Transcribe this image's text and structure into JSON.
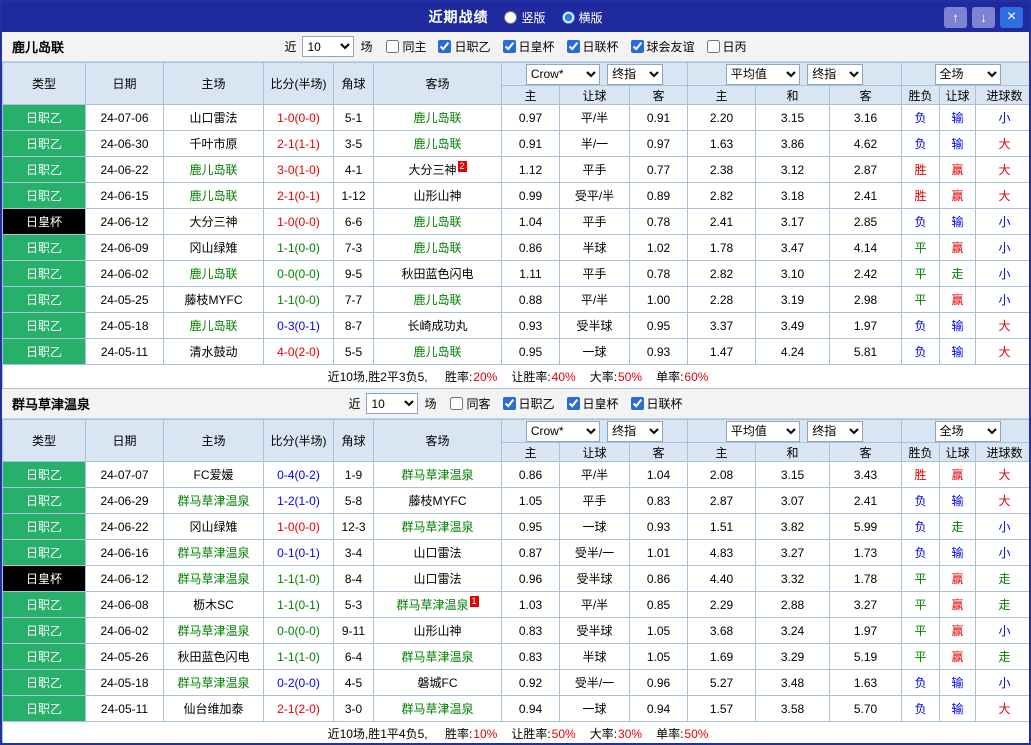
{
  "titlebar": {
    "title": "近期战绩",
    "layout_options": [
      {
        "label": "竖版",
        "selected": false
      },
      {
        "label": "横版",
        "selected": true
      }
    ],
    "buttons": {
      "up": "↑",
      "down": "↓",
      "close": "×"
    }
  },
  "table": {
    "columns": [
      "类型",
      "日期",
      "主场",
      "比分(半场)",
      "角球",
      "客场"
    ],
    "sub_headers": [
      "主",
      "让球",
      "客",
      "主",
      "和",
      "客",
      "胜负",
      "让球",
      "进球数"
    ]
  },
  "colors": {
    "focus_team": "#008000",
    "score": {
      "home": "#e60000",
      "away": "#0000ee",
      "draw": "#008000"
    },
    "outcome": {
      "胜": "#e60000",
      "赢": "#e60000",
      "大": "#e60000",
      "平": "#008000",
      "走": "#008000",
      "负": "#0000ee",
      "输": "#0000ee",
      "小": "#0000ee"
    },
    "comp": {
      "日职乙": "#27b06a",
      "日皇杯": "#000000"
    }
  },
  "sections": [
    {
      "team": "鹿儿岛联",
      "filter": {
        "near_label": "近",
        "count": "10",
        "games_label": "场",
        "checkboxes": [
          {
            "label": "同主",
            "checked": false
          },
          {
            "label": "日职乙",
            "checked": true
          },
          {
            "label": "日皇杯",
            "checked": true
          },
          {
            "label": "日联杯",
            "checked": true
          },
          {
            "label": "球会友谊",
            "checked": true
          },
          {
            "label": "日丙",
            "checked": false
          }
        ]
      },
      "dropdowns": {
        "company": "Crow*",
        "company_stage": "终指",
        "average": "平均值",
        "average_stage": "终指",
        "scope": "全场"
      },
      "rows": [
        {
          "comp": "日职乙",
          "date": "24-07-06",
          "home": "山口雷法",
          "home_focus": false,
          "home_badge": "",
          "score": "1-0(0-0)",
          "score_result": "home",
          "corner": "5-1",
          "away": "鹿儿岛联",
          "away_focus": true,
          "away_badge": "",
          "handicap": [
            "0.97",
            "平/半",
            "0.91"
          ],
          "europe": [
            "2.20",
            "3.15",
            "3.16"
          ],
          "outcome": [
            "负",
            "输",
            "小"
          ]
        },
        {
          "comp": "日职乙",
          "date": "24-06-30",
          "home": "千叶市原",
          "home_focus": false,
          "home_badge": "",
          "score": "2-1(1-1)",
          "score_result": "home",
          "corner": "3-5",
          "away": "鹿儿岛联",
          "away_focus": true,
          "away_badge": "",
          "handicap": [
            "0.91",
            "半/一",
            "0.97"
          ],
          "europe": [
            "1.63",
            "3.86",
            "4.62"
          ],
          "outcome": [
            "负",
            "输",
            "大"
          ]
        },
        {
          "comp": "日职乙",
          "date": "24-06-22",
          "home": "鹿儿岛联",
          "home_focus": true,
          "home_badge": "",
          "score": "3-0(1-0)",
          "score_result": "home",
          "corner": "4-1",
          "away": "大分三神",
          "away_focus": false,
          "away_badge": "2",
          "handicap": [
            "1.12",
            "平手",
            "0.77"
          ],
          "europe": [
            "2.38",
            "3.12",
            "2.87"
          ],
          "outcome": [
            "胜",
            "赢",
            "大"
          ]
        },
        {
          "comp": "日职乙",
          "date": "24-06-15",
          "home": "鹿儿岛联",
          "home_focus": true,
          "home_badge": "",
          "score": "2-1(0-1)",
          "score_result": "home",
          "corner": "1-12",
          "away": "山形山神",
          "away_focus": false,
          "away_badge": "",
          "handicap": [
            "0.99",
            "受平/半",
            "0.89"
          ],
          "europe": [
            "2.82",
            "3.18",
            "2.41"
          ],
          "outcome": [
            "胜",
            "赢",
            "大"
          ]
        },
        {
          "comp": "日皇杯",
          "date": "24-06-12",
          "home": "大分三神",
          "home_focus": false,
          "home_badge": "",
          "score": "1-0(0-0)",
          "score_result": "home",
          "corner": "6-6",
          "away": "鹿儿岛联",
          "away_focus": true,
          "away_badge": "",
          "handicap": [
            "1.04",
            "平手",
            "0.78"
          ],
          "europe": [
            "2.41",
            "3.17",
            "2.85"
          ],
          "outcome": [
            "负",
            "输",
            "小"
          ]
        },
        {
          "comp": "日职乙",
          "date": "24-06-09",
          "home": "冈山绿雉",
          "home_focus": false,
          "home_badge": "",
          "score": "1-1(0-0)",
          "score_result": "draw",
          "corner": "7-3",
          "away": "鹿儿岛联",
          "away_focus": true,
          "away_badge": "",
          "handicap": [
            "0.86",
            "半球",
            "1.02"
          ],
          "europe": [
            "1.78",
            "3.47",
            "4.14"
          ],
          "outcome": [
            "平",
            "赢",
            "小"
          ]
        },
        {
          "comp": "日职乙",
          "date": "24-06-02",
          "home": "鹿儿岛联",
          "home_focus": true,
          "home_badge": "",
          "score": "0-0(0-0)",
          "score_result": "draw",
          "corner": "9-5",
          "away": "秋田蓝色闪电",
          "away_focus": false,
          "away_badge": "",
          "handicap": [
            "1.11",
            "平手",
            "0.78"
          ],
          "europe": [
            "2.82",
            "3.10",
            "2.42"
          ],
          "outcome": [
            "平",
            "走",
            "小"
          ]
        },
        {
          "comp": "日职乙",
          "date": "24-05-25",
          "home": "藤枝MYFC",
          "home_focus": false,
          "home_badge": "",
          "score": "1-1(0-0)",
          "score_result": "draw",
          "corner": "7-7",
          "away": "鹿儿岛联",
          "away_focus": true,
          "away_badge": "",
          "handicap": [
            "0.88",
            "平/半",
            "1.00"
          ],
          "europe": [
            "2.28",
            "3.19",
            "2.98"
          ],
          "outcome": [
            "平",
            "赢",
            "小"
          ]
        },
        {
          "comp": "日职乙",
          "date": "24-05-18",
          "home": "鹿儿岛联",
          "home_focus": true,
          "home_badge": "",
          "score": "0-3(0-1)",
          "score_result": "away",
          "corner": "8-7",
          "away": "长崎成功丸",
          "away_focus": false,
          "away_badge": "",
          "handicap": [
            "0.93",
            "受半球",
            "0.95"
          ],
          "europe": [
            "3.37",
            "3.49",
            "1.97"
          ],
          "outcome": [
            "负",
            "输",
            "大"
          ]
        },
        {
          "comp": "日职乙",
          "date": "24-05-11",
          "home": "清水鼓动",
          "home_focus": false,
          "home_badge": "",
          "score": "4-0(2-0)",
          "score_result": "home",
          "corner": "5-5",
          "away": "鹿儿岛联",
          "away_focus": true,
          "away_badge": "",
          "handicap": [
            "0.95",
            "一球",
            "0.93"
          ],
          "europe": [
            "1.47",
            "4.24",
            "5.81"
          ],
          "outcome": [
            "负",
            "输",
            "大"
          ]
        }
      ],
      "summary": {
        "prefix": "近10场,胜2平3负5, ",
        "stats": [
          {
            "label": "胜率:",
            "value": "20%",
            "color": "#e60000"
          },
          {
            "label": "让胜率:",
            "value": "40%",
            "color": "#e60000"
          },
          {
            "label": "大率:",
            "value": "50%",
            "color": "#e60000"
          },
          {
            "label": "单率:",
            "value": "60%",
            "color": "#e60000"
          }
        ]
      }
    },
    {
      "team": "群马草津温泉",
      "filter": {
        "near_label": "近",
        "count": "10",
        "games_label": "场",
        "checkboxes": [
          {
            "label": "同客",
            "checked": false
          },
          {
            "label": "日职乙",
            "checked": true
          },
          {
            "label": "日皇杯",
            "checked": true
          },
          {
            "label": "日联杯",
            "checked": true
          }
        ]
      },
      "dropdowns": {
        "company": "Crow*",
        "company_stage": "终指",
        "average": "平均值",
        "average_stage": "终指",
        "scope": "全场"
      },
      "rows": [
        {
          "comp": "日职乙",
          "date": "24-07-07",
          "home": "FC爱媛",
          "home_focus": false,
          "home_badge": "",
          "score": "0-4(0-2)",
          "score_result": "away",
          "corner": "1-9",
          "away": "群马草津温泉",
          "away_focus": true,
          "away_badge": "",
          "handicap": [
            "0.86",
            "平/半",
            "1.04"
          ],
          "europe": [
            "2.08",
            "3.15",
            "3.43"
          ],
          "outcome": [
            "胜",
            "赢",
            "大"
          ]
        },
        {
          "comp": "日职乙",
          "date": "24-06-29",
          "home": "群马草津温泉",
          "home_focus": true,
          "home_badge": "",
          "score": "1-2(1-0)",
          "score_result": "away",
          "corner": "5-8",
          "away": "藤枝MYFC",
          "away_focus": false,
          "away_badge": "",
          "handicap": [
            "1.05",
            "平手",
            "0.83"
          ],
          "europe": [
            "2.87",
            "3.07",
            "2.41"
          ],
          "outcome": [
            "负",
            "输",
            "大"
          ]
        },
        {
          "comp": "日职乙",
          "date": "24-06-22",
          "home": "冈山绿雉",
          "home_focus": false,
          "home_badge": "",
          "score": "1-0(0-0)",
          "score_result": "home",
          "corner": "12-3",
          "away": "群马草津温泉",
          "away_focus": true,
          "away_badge": "",
          "handicap": [
            "0.95",
            "一球",
            "0.93"
          ],
          "europe": [
            "1.51",
            "3.82",
            "5.99"
          ],
          "outcome": [
            "负",
            "走",
            "小"
          ]
        },
        {
          "comp": "日职乙",
          "date": "24-06-16",
          "home": "群马草津温泉",
          "home_focus": true,
          "home_badge": "",
          "score": "0-1(0-1)",
          "score_result": "away",
          "corner": "3-4",
          "away": "山口雷法",
          "away_focus": false,
          "away_badge": "",
          "handicap": [
            "0.87",
            "受半/一",
            "1.01"
          ],
          "europe": [
            "4.83",
            "3.27",
            "1.73"
          ],
          "outcome": [
            "负",
            "输",
            "小"
          ]
        },
        {
          "comp": "日皇杯",
          "date": "24-06-12",
          "home": "群马草津温泉",
          "home_focus": true,
          "home_badge": "",
          "score": "1-1(1-0)",
          "score_result": "draw",
          "corner": "8-4",
          "away": "山口雷法",
          "away_focus": false,
          "away_badge": "",
          "handicap": [
            "0.96",
            "受半球",
            "0.86"
          ],
          "europe": [
            "4.40",
            "3.32",
            "1.78"
          ],
          "outcome": [
            "平",
            "赢",
            "走"
          ]
        },
        {
          "comp": "日职乙",
          "date": "24-06-08",
          "home": "枥木SC",
          "home_focus": false,
          "home_badge": "",
          "score": "1-1(0-1)",
          "score_result": "draw",
          "corner": "5-3",
          "away": "群马草津温泉",
          "away_focus": true,
          "away_badge": "1",
          "handicap": [
            "1.03",
            "平/半",
            "0.85"
          ],
          "europe": [
            "2.29",
            "2.88",
            "3.27"
          ],
          "outcome": [
            "平",
            "赢",
            "走"
          ]
        },
        {
          "comp": "日职乙",
          "date": "24-06-02",
          "home": "群马草津温泉",
          "home_focus": true,
          "home_badge": "",
          "score": "0-0(0-0)",
          "score_result": "draw",
          "corner": "9-11",
          "away": "山形山神",
          "away_focus": false,
          "away_badge": "",
          "handicap": [
            "0.83",
            "受半球",
            "1.05"
          ],
          "europe": [
            "3.68",
            "3.24",
            "1.97"
          ],
          "outcome": [
            "平",
            "赢",
            "小"
          ]
        },
        {
          "comp": "日职乙",
          "date": "24-05-26",
          "home": "秋田蓝色闪电",
          "home_focus": false,
          "home_badge": "",
          "score": "1-1(1-0)",
          "score_result": "draw",
          "corner": "6-4",
          "away": "群马草津温泉",
          "away_focus": true,
          "away_badge": "",
          "handicap": [
            "0.83",
            "半球",
            "1.05"
          ],
          "europe": [
            "1.69",
            "3.29",
            "5.19"
          ],
          "outcome": [
            "平",
            "赢",
            "走"
          ]
        },
        {
          "comp": "日职乙",
          "date": "24-05-18",
          "home": "群马草津温泉",
          "home_focus": true,
          "home_badge": "",
          "score": "0-2(0-0)",
          "score_result": "away",
          "corner": "4-5",
          "away": "磐城FC",
          "away_focus": false,
          "away_badge": "",
          "handicap": [
            "0.92",
            "受半/一",
            "0.96"
          ],
          "europe": [
            "5.27",
            "3.48",
            "1.63"
          ],
          "outcome": [
            "负",
            "输",
            "小"
          ]
        },
        {
          "comp": "日职乙",
          "date": "24-05-11",
          "home": "仙台维加泰",
          "home_focus": false,
          "home_badge": "",
          "score": "2-1(2-0)",
          "score_result": "home",
          "corner": "3-0",
          "away": "群马草津温泉",
          "away_focus": true,
          "away_badge": "",
          "handicap": [
            "0.94",
            "一球",
            "0.94"
          ],
          "europe": [
            "1.57",
            "3.58",
            "5.70"
          ],
          "outcome": [
            "负",
            "输",
            "大"
          ]
        }
      ],
      "summary": {
        "prefix": "近10场,胜1平4负5, ",
        "stats": [
          {
            "label": "胜率:",
            "value": "10%",
            "color": "#e60000"
          },
          {
            "label": "让胜率:",
            "value": "50%",
            "color": "#e60000"
          },
          {
            "label": "大率:",
            "value": "30%",
            "color": "#e60000"
          },
          {
            "label": "单率:",
            "value": "50%",
            "color": "#e60000"
          }
        ]
      }
    }
  ]
}
